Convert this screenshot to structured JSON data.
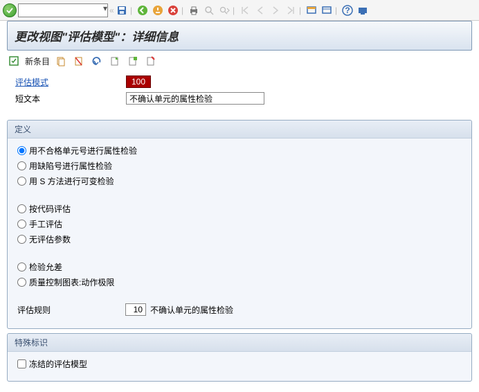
{
  "title": "更改视图\"评估模型\"：详细信息",
  "cmd": "",
  "app_toolbar": {
    "new_entry": "新条目"
  },
  "form": {
    "eval_mode_label": "评估模式",
    "eval_mode_value": "100",
    "short_text_label": "短文本",
    "short_text_value": "不确认单元的属性检验"
  },
  "definition": {
    "title": "定义",
    "opts": [
      "用不合格单元号进行属性检验",
      "用缺陷号进行属性检验",
      "用 S 方法进行可变检验",
      "按代码评估",
      "手工评估",
      "无评估参数",
      "检验允差",
      "质量控制图表:动作极限"
    ],
    "selected": 0,
    "eval_rule_label": "评估规则",
    "eval_rule_value": "10",
    "eval_rule_text": "不确认单元的属性检验"
  },
  "special": {
    "title": "特殊标识",
    "frozen_label": "冻结的评估模型",
    "frozen_checked": false
  }
}
